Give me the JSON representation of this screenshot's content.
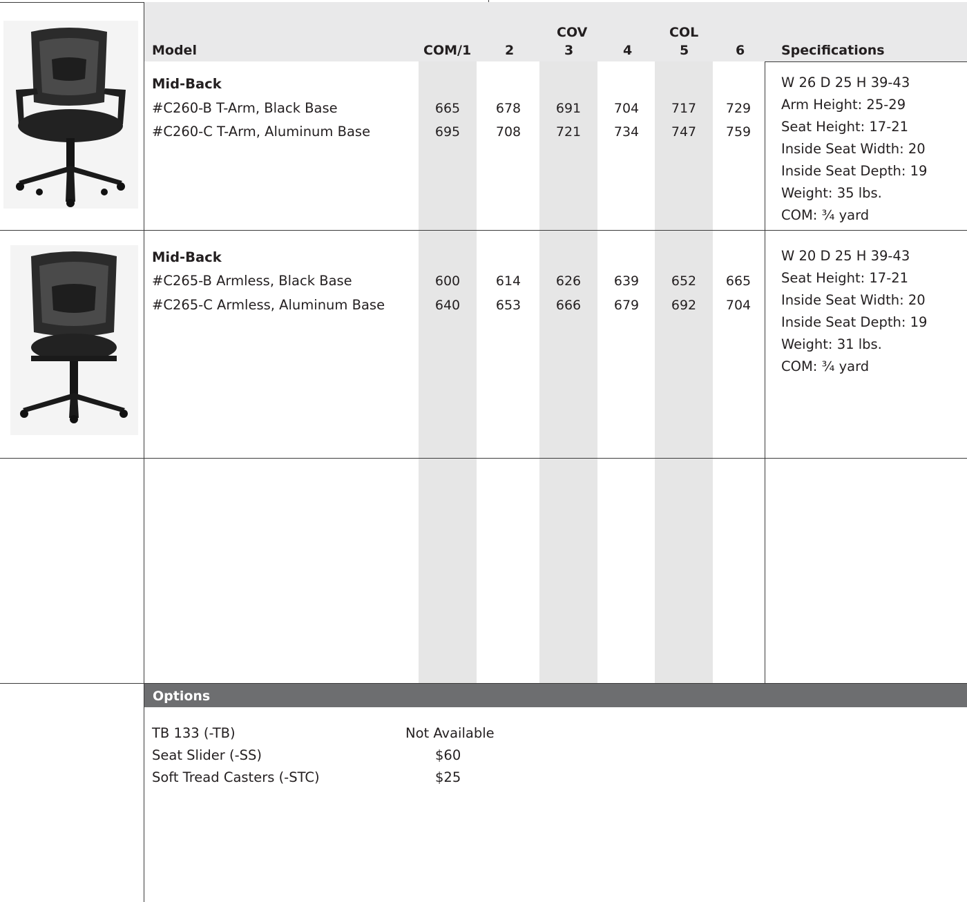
{
  "header": {
    "model": "Model",
    "cov": "COV",
    "col": "COL",
    "grades": [
      "COM/1",
      "2",
      "3",
      "4",
      "5",
      "6"
    ],
    "specifications": "Specifications"
  },
  "products": [
    {
      "title": "Mid-Back",
      "rows": [
        {
          "label": "#C260-B T-Arm, Black Base",
          "prices": [
            "665",
            "678",
            "691",
            "704",
            "717",
            "729"
          ]
        },
        {
          "label": "#C260-C T-Arm, Aluminum Base",
          "prices": [
            "695",
            "708",
            "721",
            "734",
            "747",
            "759"
          ]
        }
      ],
      "specs": [
        "W 26  D 25  H 39-43",
        "Arm Height: 25-29",
        "Seat Height: 17-21",
        "Inside Seat Width: 20",
        "Inside Seat Depth: 19",
        "Weight: 35 lbs.",
        "COM: ³⁄₄ yard"
      ]
    },
    {
      "title": "Mid-Back",
      "rows": [
        {
          "label": "#C265-B Armless, Black Base",
          "prices": [
            "600",
            "614",
            "626",
            "639",
            "652",
            "665"
          ]
        },
        {
          "label": "#C265-C Armless, Aluminum Base",
          "prices": [
            "640",
            "653",
            "666",
            "679",
            "692",
            "704"
          ]
        }
      ],
      "specs": [
        "W 20  D 25  H 39-43",
        "Seat Height: 17-21",
        "Inside Seat Width: 20",
        "Inside Seat Depth: 19",
        "Weight: 31 lbs.",
        "COM: ³⁄₄ yard"
      ]
    }
  ],
  "options": {
    "title": "Options",
    "items": [
      {
        "label": "TB 133 (-TB)",
        "price": "Not Available"
      },
      {
        "label": "Seat Slider (-SS)",
        "price": "$60"
      },
      {
        "label": "Soft Tread Casters (-STC)",
        "price": "$25"
      }
    ]
  },
  "colors": {
    "header_bg": "#e9e9ea",
    "column_shade": "#e6e6e6",
    "options_bar": "#6d6e70"
  }
}
